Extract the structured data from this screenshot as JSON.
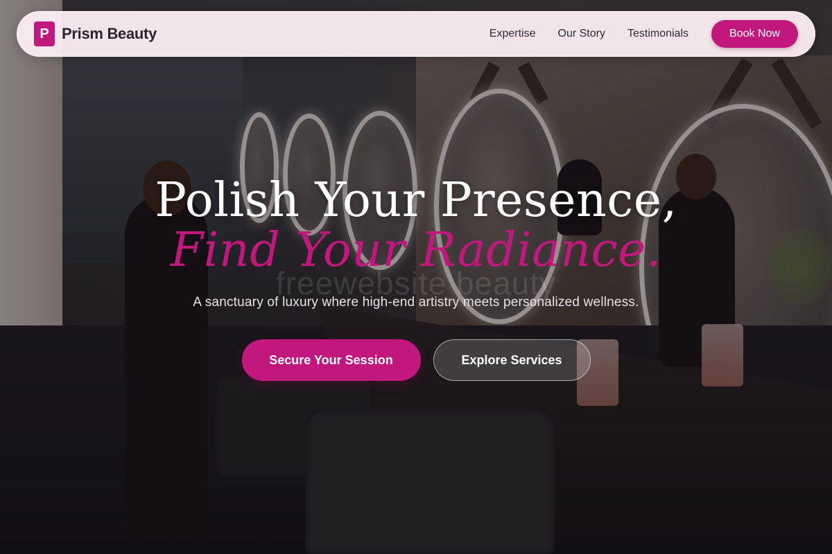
{
  "nav": {
    "brand": {
      "logo_letter": "P",
      "name": "Prism Beauty"
    },
    "links": [
      {
        "label": "Expertise"
      },
      {
        "label": "Our Story"
      },
      {
        "label": "Testimonials"
      }
    ],
    "cta_label": "Book Now"
  },
  "hero": {
    "headline_line1": "Polish Your Presence,",
    "headline_line2": "Find Your Radiance.",
    "watermark": "freewebsite beauty",
    "tagline": "A sanctuary of luxury where high-end artistry meets personalized wellness.",
    "primary_cta": "Secure Your Session",
    "secondary_cta": "Explore Services",
    "background_image": "salon-interior-photo"
  },
  "colors": {
    "accent": "#c2187e",
    "nav_bg": "#fdeef3",
    "text_dark": "#2a2330",
    "text_light": "#ffffff"
  }
}
